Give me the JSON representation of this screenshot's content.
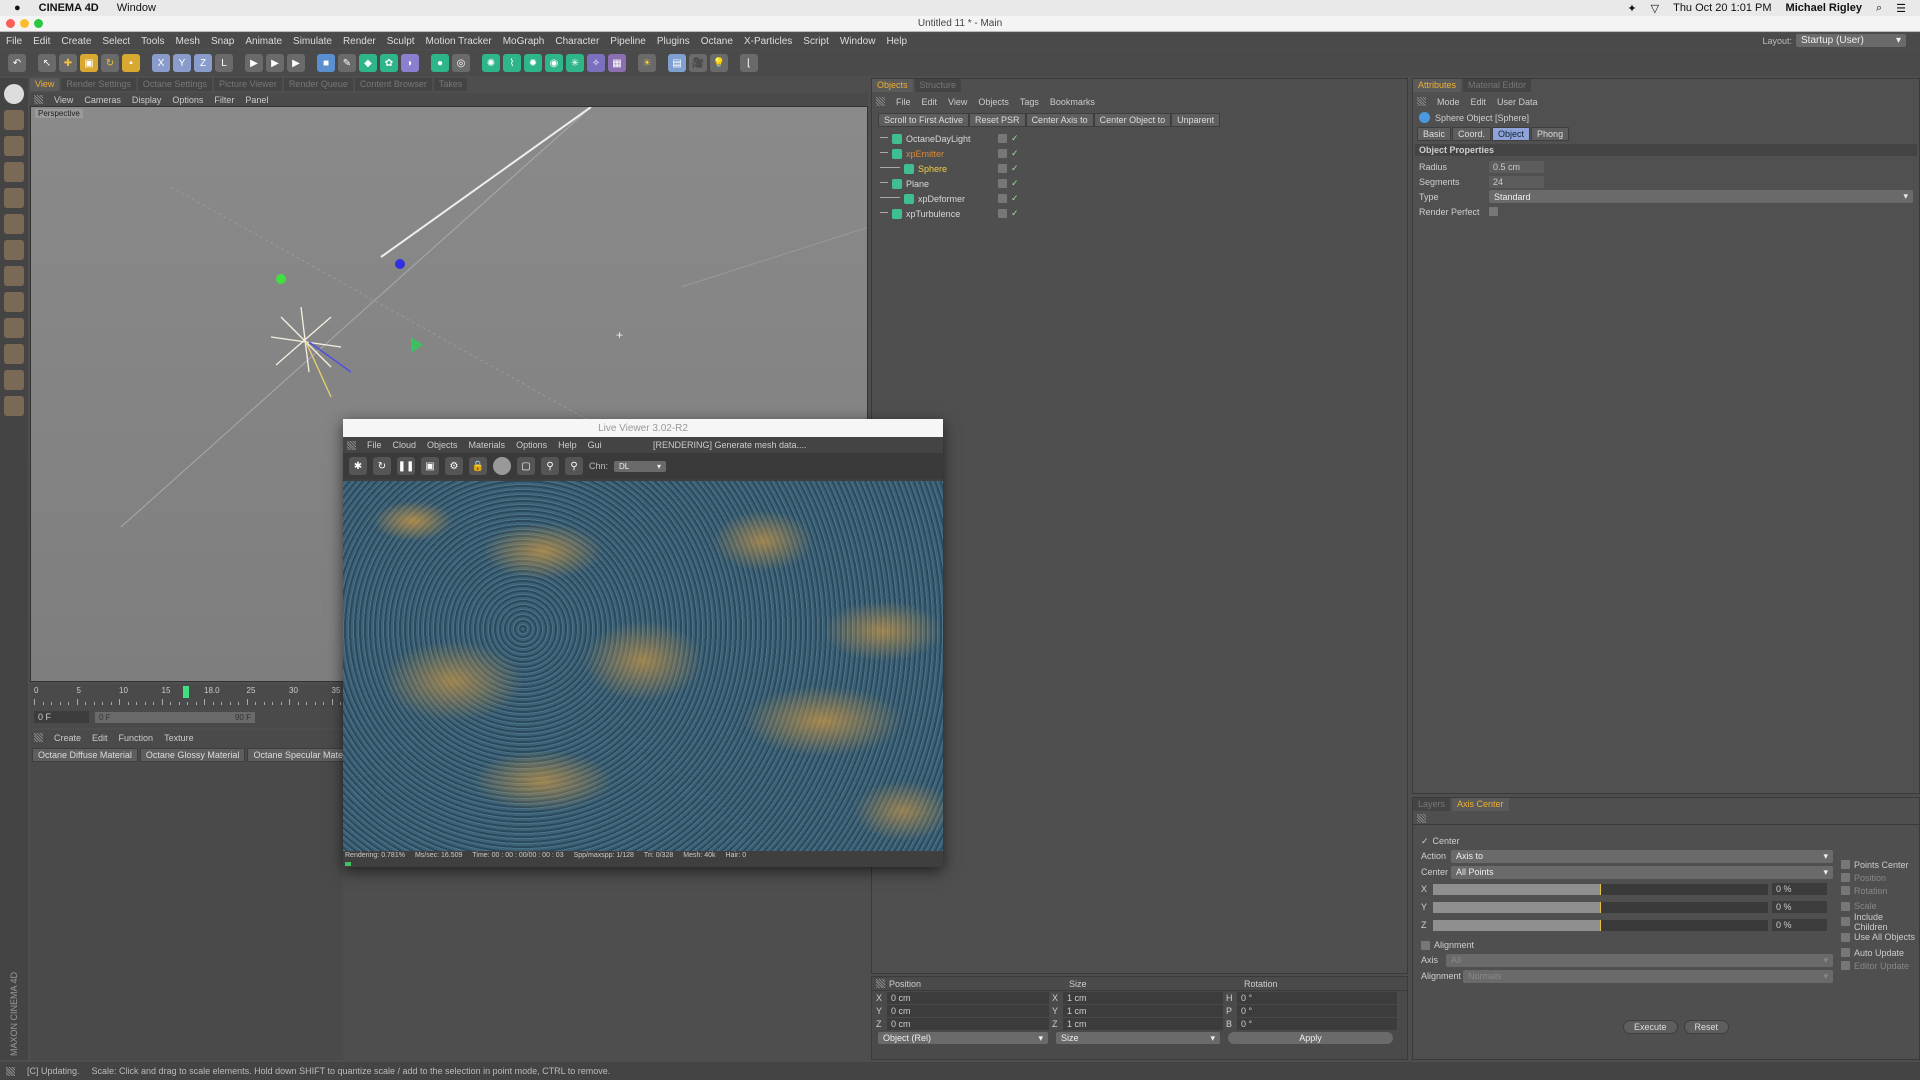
{
  "macbar": {
    "app": "CINEMA 4D",
    "menu": "Window",
    "datetime": "Thu Oct 20  1:01 PM",
    "user": "Michael Rigley"
  },
  "window": {
    "title": "Untitled 11 * - Main"
  },
  "menu": [
    "File",
    "Edit",
    "Create",
    "Select",
    "Tools",
    "Mesh",
    "Snap",
    "Animate",
    "Simulate",
    "Render",
    "Sculpt",
    "Motion Tracker",
    "MoGraph",
    "Character",
    "Pipeline",
    "Plugins",
    "Octane",
    "X-Particles",
    "Script",
    "Window",
    "Help"
  ],
  "toolbar": {
    "axis_buttons": [
      "X",
      "Y",
      "Z"
    ]
  },
  "layout": {
    "label": "Layout:",
    "value": "Startup (User)"
  },
  "viewport": {
    "tabs": [
      "View",
      "Render Settings",
      "Octane Settings",
      "Picture Viewer",
      "Render Queue",
      "Content Browser",
      "Takes"
    ],
    "menu": [
      "View",
      "Cameras",
      "Display",
      "Options",
      "Filter",
      "Panel"
    ],
    "label": "Perspective"
  },
  "timeline": {
    "ticks": [
      "0",
      "5",
      "10",
      "15",
      "18.0",
      "25",
      "30",
      "35"
    ],
    "current_frame": 18,
    "start_field": "0 F",
    "range_start": "0 F",
    "range_end": "90 F"
  },
  "materials": {
    "menu": [
      "Create",
      "Edit",
      "Function",
      "Texture"
    ],
    "items": [
      "Octane Diffuse Material",
      "Octane Glossy Material",
      "Octane Specular Material"
    ]
  },
  "live_viewer": {
    "title": "Live Viewer 3.02-R2",
    "menu": [
      "File",
      "Cloud",
      "Objects",
      "Materials",
      "Options",
      "Help",
      "Gui"
    ],
    "status": "[RENDERING] Generate mesh data....",
    "channel_label": "Chn:",
    "channel": "DL",
    "stats": [
      "Rendering: 0.781%",
      "Ms/sec: 16.509",
      "Time: 00 : 00 : 00/00 : 00 : 03",
      "Spp/maxspp: 1/128",
      "Tri: 0/328",
      "Mesh: 40k",
      "Hair: 0"
    ],
    "progress_percent": 0.781
  },
  "objects": {
    "tabs": [
      "Objects",
      "Structure"
    ],
    "menu": [
      "File",
      "Edit",
      "View",
      "Objects",
      "Tags",
      "Bookmarks"
    ],
    "buttons": [
      "Scroll to First Active",
      "Reset PSR",
      "Center Axis to",
      "Center Object to",
      "Unparent"
    ],
    "tree": [
      {
        "name": "OctaneDayLight",
        "indent": 0,
        "color": "#d8d8d8"
      },
      {
        "name": "xpEmitter",
        "indent": 0,
        "color": "#d88a3a"
      },
      {
        "name": "Sphere",
        "indent": 1,
        "color": "#f0d040"
      },
      {
        "name": "Plane",
        "indent": 0,
        "color": "#d8d8d8"
      },
      {
        "name": "xpDeformer",
        "indent": 1,
        "color": "#d8d8d8"
      },
      {
        "name": "xpTurbulence",
        "indent": 0,
        "color": "#d8d8d8"
      }
    ]
  },
  "coords": {
    "headers": [
      "Position",
      "Size",
      "Rotation"
    ],
    "rows": [
      {
        "a": "X",
        "p": "0 cm",
        "s_axis": "X",
        "s": "1 cm",
        "r_axis": "H",
        "r": "0 °"
      },
      {
        "a": "Y",
        "p": "0 cm",
        "s_axis": "Y",
        "s": "1 cm",
        "r_axis": "P",
        "r": "0 °"
      },
      {
        "a": "Z",
        "p": "0 cm",
        "s_axis": "Z",
        "s": "1 cm",
        "r_axis": "B",
        "r": "0 °"
      }
    ],
    "mode": "Object (Rel)",
    "size_mode": "Size",
    "apply": "Apply"
  },
  "attributes": {
    "tabs": [
      "Attributes",
      "Material Editor"
    ],
    "menu": [
      "Mode",
      "Edit",
      "User Data"
    ],
    "object_title": "Sphere Object [Sphere]",
    "subtabs": [
      "Basic",
      "Coord.",
      "Object",
      "Phong"
    ],
    "active_subtab": "Object",
    "section": "Object Properties",
    "radius_label": "Radius",
    "radius": "0.5 cm",
    "segments_label": "Segments",
    "segments": "24",
    "type_label": "Type",
    "type": "Standard",
    "render_perfect_label": "Render Perfect",
    "render_perfect": false
  },
  "axis_center": {
    "tabs": [
      "Layers",
      "Axis Center"
    ],
    "center_label": "Center",
    "center_checked": true,
    "action_label": "Action",
    "action": "Axis to",
    "center_sel_label": "Center",
    "center_sel": "All Points",
    "sliders": [
      {
        "axis": "X",
        "value": "0 %",
        "fraction": 0.5
      },
      {
        "axis": "Y",
        "value": "0 %",
        "fraction": 0.5
      },
      {
        "axis": "Z",
        "value": "0 %",
        "fraction": 0.5
      }
    ],
    "right_options": [
      "Points Center",
      "Position",
      "Rotation",
      "Scale",
      "Include Children",
      "Use All Objects",
      "Auto Update",
      "Editor Update"
    ],
    "alignment_label": "Alignment",
    "axis_label": "Axis",
    "axis_value": "All",
    "alignment2_label": "Alignment",
    "alignment_value": "Normals",
    "execute": "Execute",
    "reset": "Reset"
  },
  "status": {
    "state": "[C]  Updating.",
    "hint": "Scale: Click and drag to scale elements. Hold down SHIFT to quantize scale / add to the selection in point mode, CTRL to remove."
  },
  "branding": "MAXON CINEMA 4D",
  "colors": {
    "accent": "#f0b030",
    "ui_bg": "#4e4e4e",
    "green_tool": "#2fb58a"
  }
}
